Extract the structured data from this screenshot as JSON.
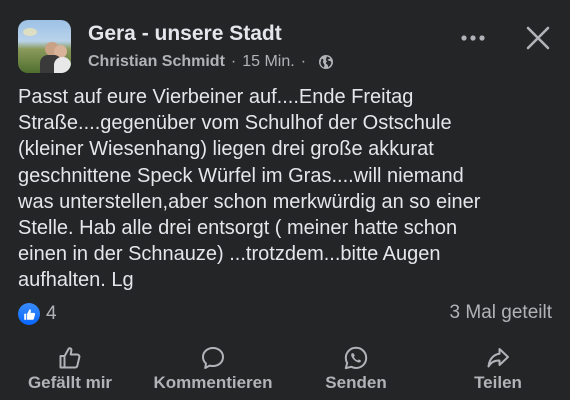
{
  "header": {
    "group_name": "Gera - unsere Stadt",
    "author": "Christian Schmidt",
    "separator": "·",
    "time": "15 Min.",
    "visibility_icon": "globe-icon",
    "more_icon": "more-horizontal-icon",
    "close_icon": "close-icon"
  },
  "post": {
    "text": "Passt auf eure Vierbeiner auf....Ende Freitag\nStraße....gegenüber vom Schulhof der Ostschule\n(kleiner Wiesenhang) liegen drei große akkurat\ngeschnittene Speck Würfel im Gras....will niemand\nwas unterstellen,aber schon merkwürdig an so einer\nStelle. Hab alle drei entsorgt ( meiner hatte schon\neinen in der Schnauze) ...trotzdem...bitte Augen\naufhalten. Lg"
  },
  "stats": {
    "reaction_icon": "like-reaction-icon",
    "reaction_count": "4",
    "shares": "3 Mal geteilt"
  },
  "actions": {
    "like": {
      "label": "Gefällt mir",
      "icon": "thumbs-up-icon"
    },
    "comment": {
      "label": "Kommentieren",
      "icon": "comment-bubble-icon"
    },
    "send": {
      "label": "Senden",
      "icon": "whatsapp-icon"
    },
    "share": {
      "label": "Teilen",
      "icon": "share-arrow-icon"
    }
  },
  "colors": {
    "background": "#242526",
    "primary_text": "#e4e6eb",
    "secondary_text": "#b0b3b8",
    "like_blue": "#0866ff"
  }
}
